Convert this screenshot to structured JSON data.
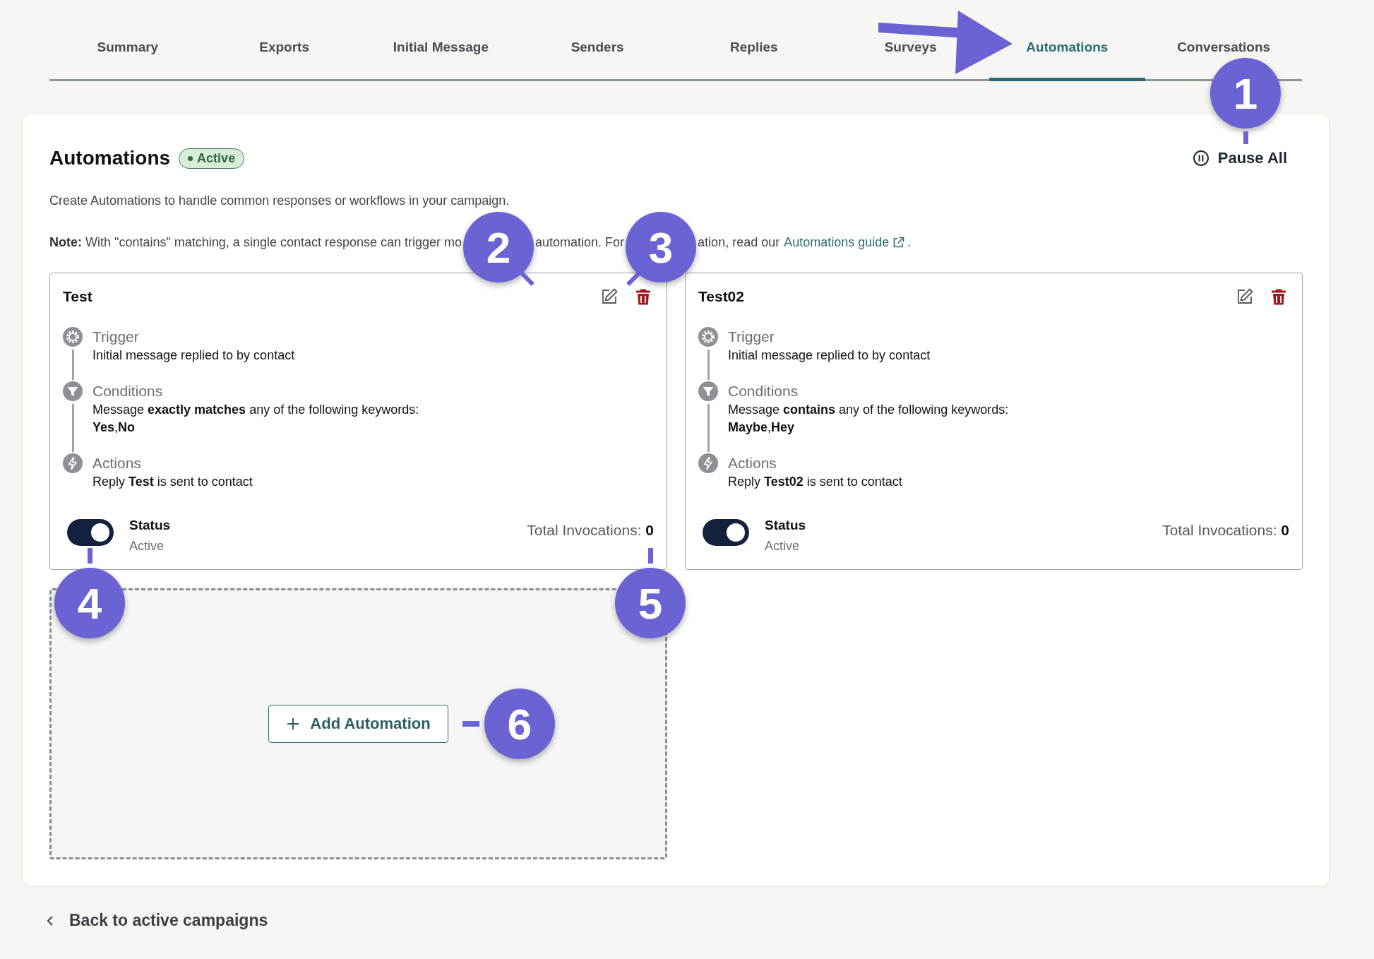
{
  "tabs": [
    {
      "label": "Summary",
      "selected": false
    },
    {
      "label": "Exports",
      "selected": false
    },
    {
      "label": "Initial Message",
      "selected": false
    },
    {
      "label": "Senders",
      "selected": false
    },
    {
      "label": "Replies",
      "selected": false
    },
    {
      "label": "Surveys",
      "selected": false
    },
    {
      "label": "Automations",
      "selected": true
    },
    {
      "label": "Conversations",
      "selected": false
    }
  ],
  "header": {
    "title": "Automations",
    "badge": "Active",
    "pause_button": "Pause All"
  },
  "description": "Create Automations to handle common responses or workflows in your campaign.",
  "note": {
    "segments": [
      "**Note:** With \"contains\" matching, a single contact response can trigger mo",
      "automation. For",
      "ation, read our"
    ],
    "link": "Automations guide",
    "end": "."
  },
  "automations": [
    {
      "title": "Test",
      "steps": [
        {
          "kind": "trigger",
          "label": "Trigger",
          "lines": [
            "Initial message replied to by contact"
          ]
        },
        {
          "kind": "conditions",
          "label": "Conditions",
          "lines": [
            "Message **exactly matches** any of the following keywords:",
            "**Yes**,**No**"
          ]
        },
        {
          "kind": "actions",
          "label": "Actions",
          "lines": [
            "Reply **Test** is sent to contact"
          ]
        }
      ],
      "status": {
        "on": true,
        "label": "Status",
        "value": "Active"
      },
      "invocations": "Total Invocations: **0**"
    },
    {
      "title": "Test02",
      "steps": [
        {
          "kind": "trigger",
          "label": "Trigger",
          "lines": [
            "Initial message replied to by contact"
          ]
        },
        {
          "kind": "conditions",
          "label": "Conditions",
          "lines": [
            "Message **contains** any of the following keywords:",
            "**Maybe**,**Hey**"
          ]
        },
        {
          "kind": "actions",
          "label": "Actions",
          "lines": [
            "Reply **Test02** is sent to contact"
          ]
        }
      ],
      "status": {
        "on": true,
        "label": "Status",
        "value": "Active"
      },
      "invocations": "Total Invocations: **0**"
    }
  ],
  "add_button": "Add Automation",
  "back_link": "Back to active campaigns",
  "callouts": [
    "1",
    "2",
    "3",
    "4",
    "5",
    "6"
  ]
}
